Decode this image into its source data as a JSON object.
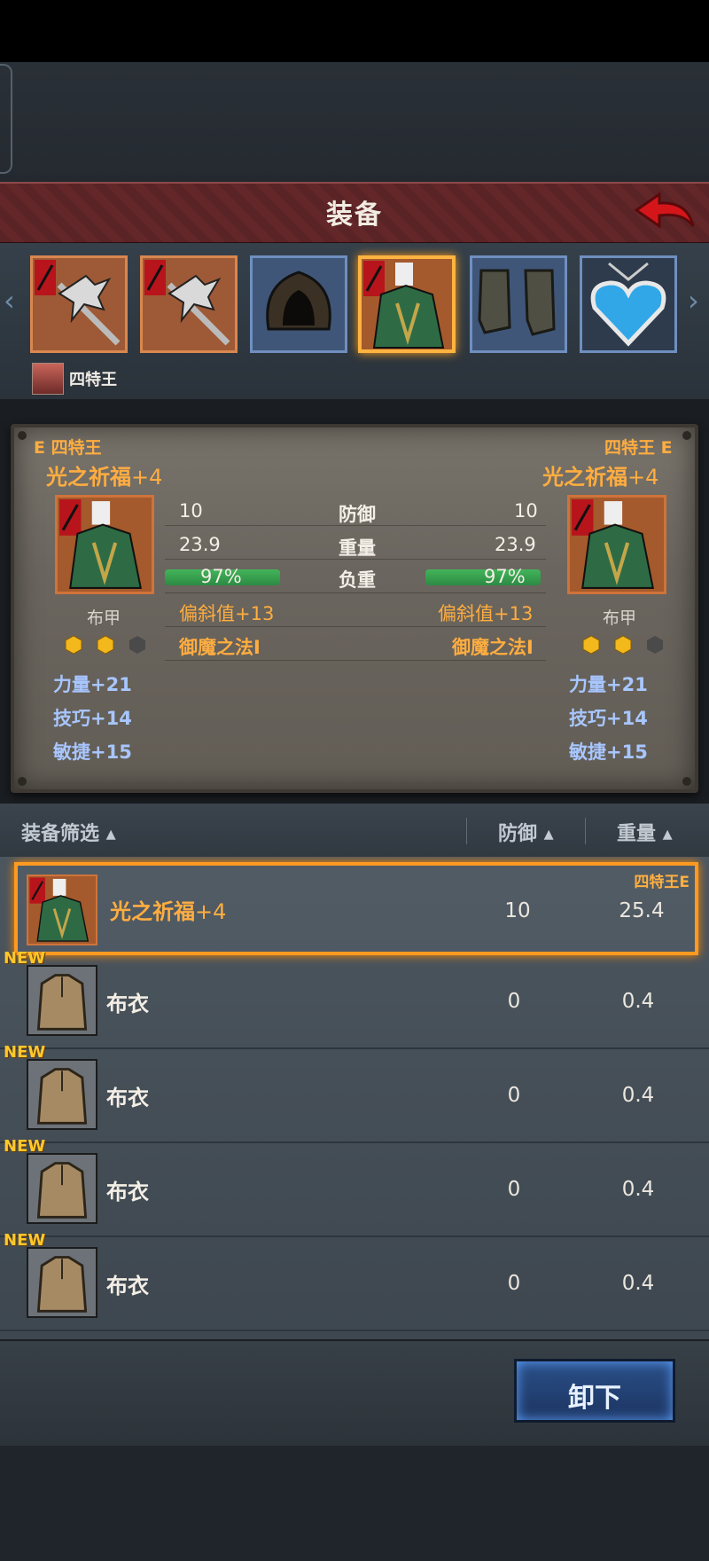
{
  "header": {
    "title": "装备"
  },
  "slots": [
    {
      "icon": "halberd-icon",
      "type": "weapon"
    },
    {
      "icon": "halberd-icon",
      "type": "weapon"
    },
    {
      "icon": "hood-icon",
      "type": "helmet"
    },
    {
      "icon": "armor-icon",
      "type": "armor",
      "selected": true
    },
    {
      "icon": "boots-icon",
      "type": "boots"
    },
    {
      "icon": "heart-pendant-icon",
      "type": "accessory"
    }
  ],
  "owner": {
    "name": "四特王"
  },
  "compare": {
    "left": {
      "owner": "E 四特王",
      "name": "光之祈福",
      "plus": "+4",
      "type": "布甲",
      "defense": "10",
      "weight": "23.9",
      "load": "97%",
      "load_value": 0.97,
      "deflect": "偏斜值+13",
      "skill": "御魔之法I",
      "gems": 2,
      "stats": [
        "力量+21",
        "技巧+14",
        "敏捷+15"
      ]
    },
    "right": {
      "owner": "四特王 E",
      "name": "光之祈福",
      "plus": "+4",
      "type": "布甲",
      "defense": "10",
      "weight": "23.9",
      "load": "97%",
      "load_value": 0.97,
      "deflect": "偏斜值+13",
      "skill": "御魔之法I",
      "gems": 2,
      "stats": [
        "力量+21",
        "技巧+14",
        "敏捷+15"
      ]
    },
    "labels": {
      "defense": "防御",
      "weight": "重量",
      "load": "负重"
    }
  },
  "list": {
    "headers": {
      "filter": "装备筛选",
      "defense": "防御",
      "weight": "重量"
    },
    "rows": [
      {
        "name": "光之祈福",
        "plus": "+4",
        "defense": "10",
        "weight": "25.4",
        "owner": "四特王E",
        "selected": true,
        "icon": "armor-icon"
      },
      {
        "name": "布衣",
        "defense": "0",
        "weight": "0.4",
        "new": "NEW",
        "icon": "cloth-shirt-icon"
      },
      {
        "name": "布衣",
        "defense": "0",
        "weight": "0.4",
        "new": "NEW",
        "icon": "cloth-shirt-icon"
      },
      {
        "name": "布衣",
        "defense": "0",
        "weight": "0.4",
        "new": "NEW",
        "icon": "cloth-shirt-icon"
      },
      {
        "name": "布衣",
        "defense": "0",
        "weight": "0.4",
        "new": "NEW",
        "icon": "cloth-shirt-icon"
      }
    ]
  },
  "actions": {
    "unequip": "卸下"
  }
}
